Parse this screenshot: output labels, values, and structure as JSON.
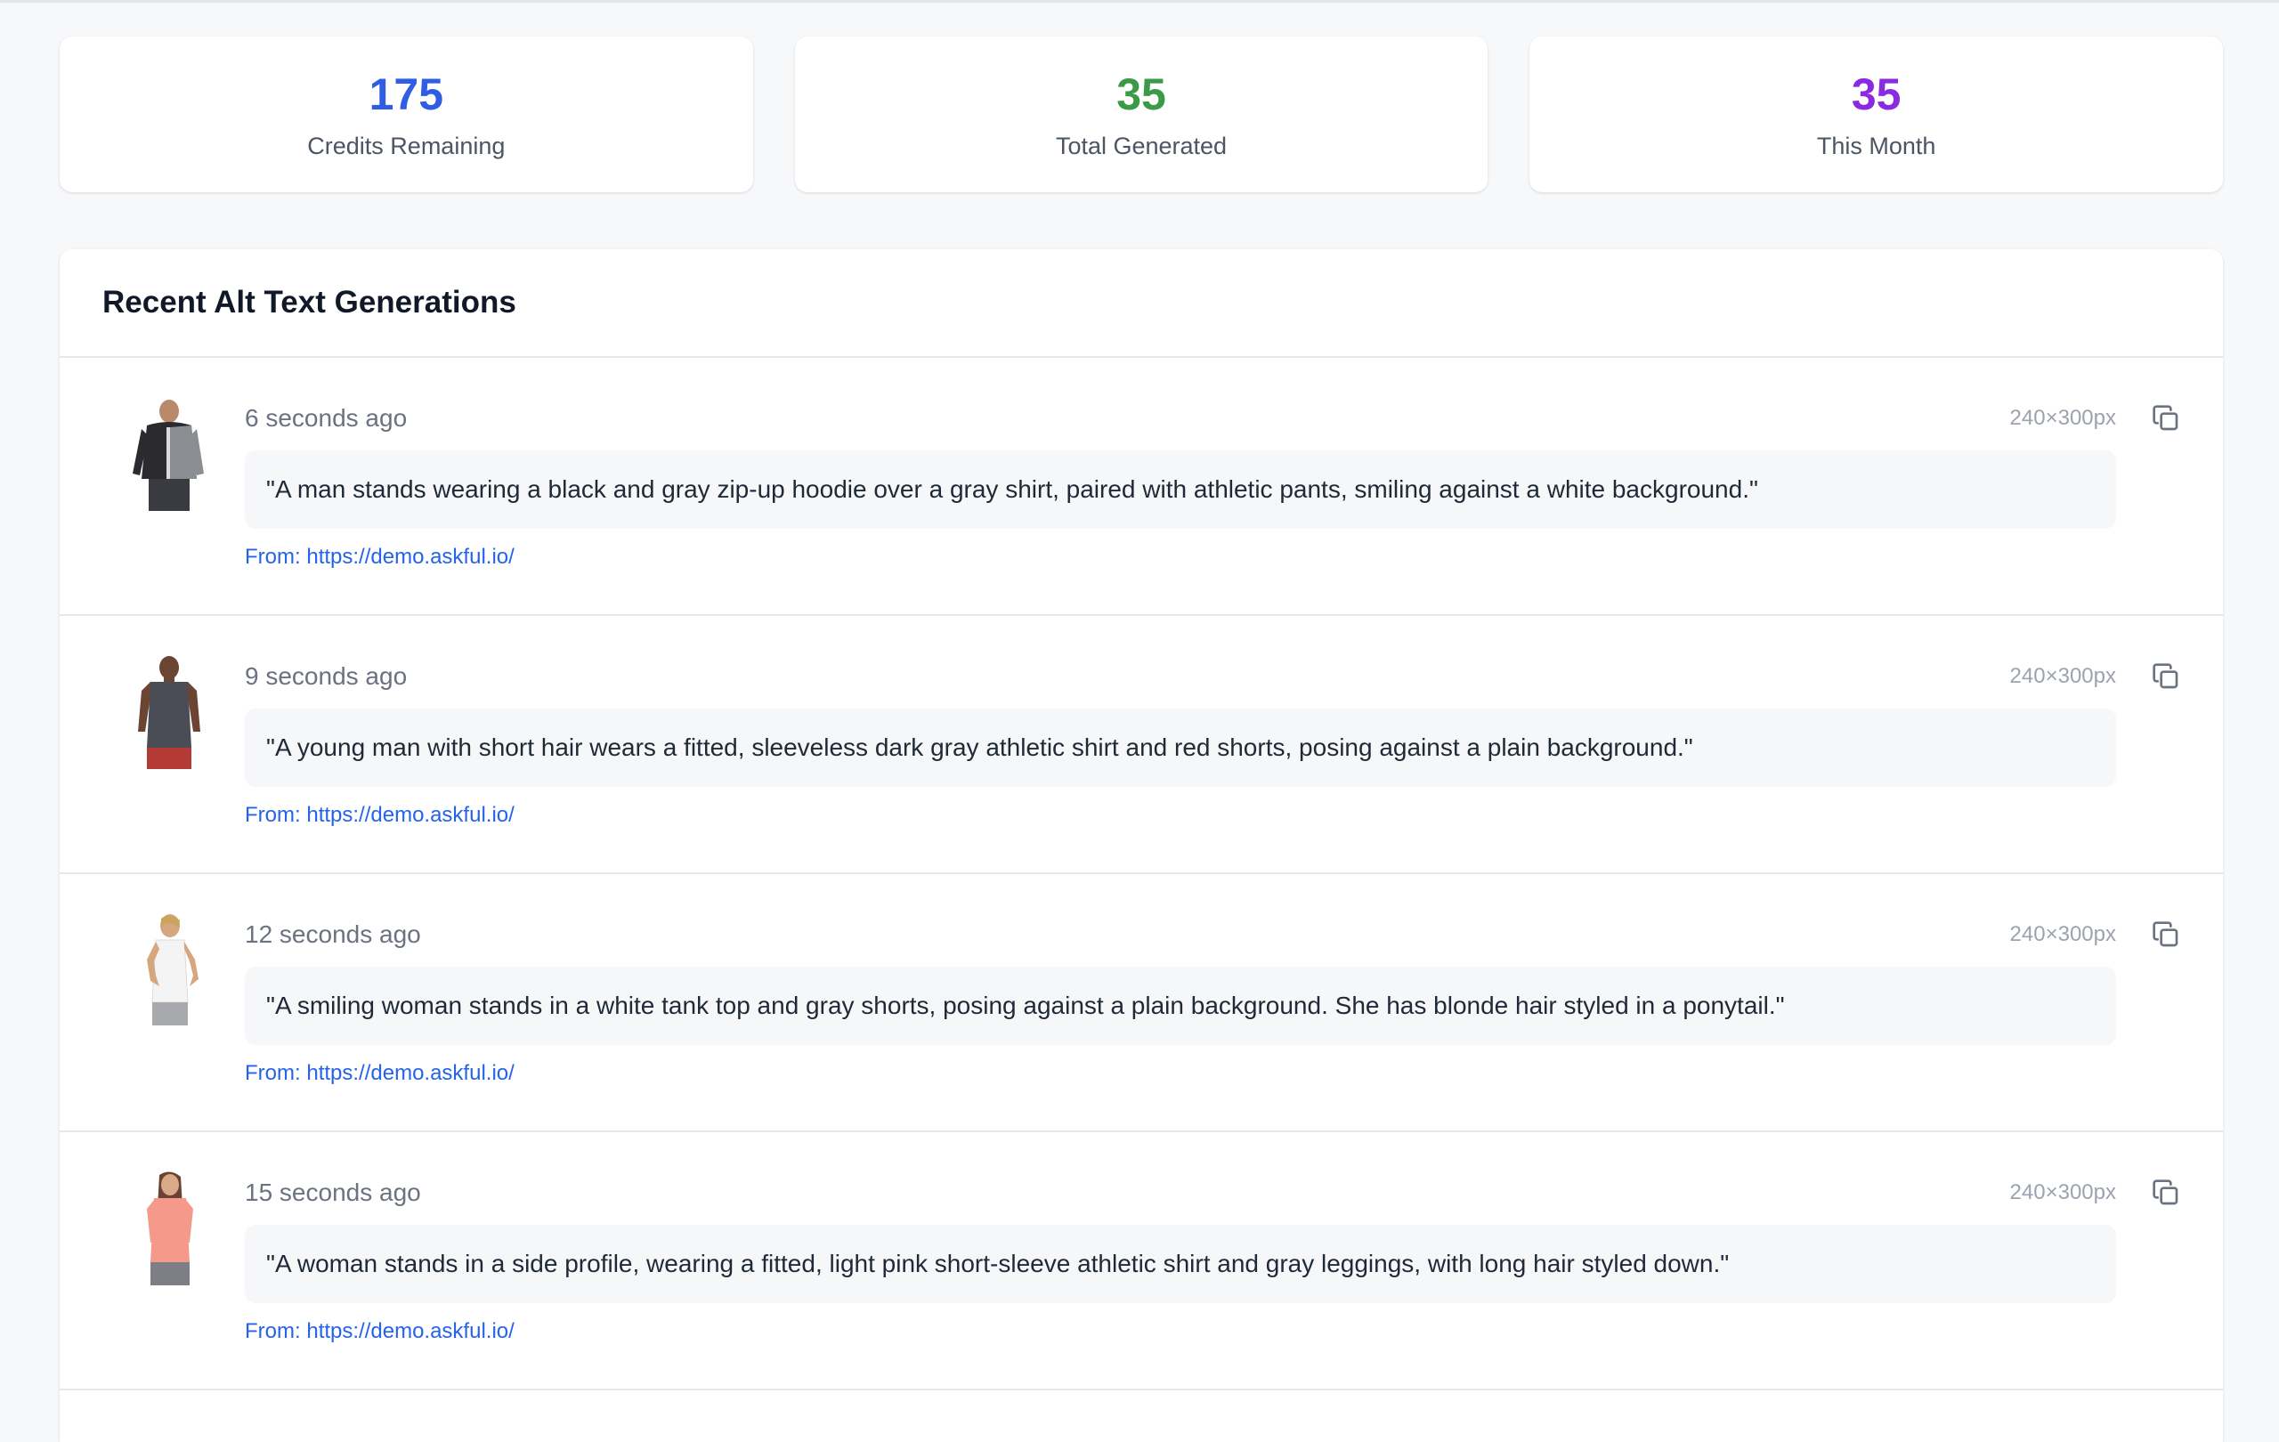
{
  "stats": [
    {
      "value": "175",
      "label": "Credits Remaining",
      "color": "#2f5ee5"
    },
    {
      "value": "35",
      "label": "Total Generated",
      "color": "#3a9a46"
    },
    {
      "value": "35",
      "label": "This Month",
      "color": "#8a2be2"
    }
  ],
  "recent": {
    "title": "Recent Alt Text Generations",
    "items": [
      {
        "time": "6 seconds ago",
        "dims": "240×300px",
        "alt": "\"A man stands wearing a black and gray zip-up hoodie over a gray shirt, paired with athletic pants, smiling against a white background.\"",
        "source_prefix": "From:",
        "source_url": "https://demo.askful.io/"
      },
      {
        "time": "9 seconds ago",
        "dims": "240×300px",
        "alt": "\"A young man with short hair wears a fitted, sleeveless dark gray athletic shirt and red shorts, posing against a plain background.\"",
        "source_prefix": "From:",
        "source_url": "https://demo.askful.io/"
      },
      {
        "time": "12 seconds ago",
        "dims": "240×300px",
        "alt": "\"A smiling woman stands in a white tank top and gray shorts, posing against a plain background. She has blonde hair styled in a ponytail.\"",
        "source_prefix": "From:",
        "source_url": "https://demo.askful.io/"
      },
      {
        "time": "15 seconds ago",
        "dims": "240×300px",
        "alt": "\"A woman stands in a side profile, wearing a fitted, light pink short-sleeve athletic shirt and gray leggings, with long hair styled down.\"",
        "source_prefix": "From:",
        "source_url": "https://demo.askful.io/"
      }
    ]
  }
}
